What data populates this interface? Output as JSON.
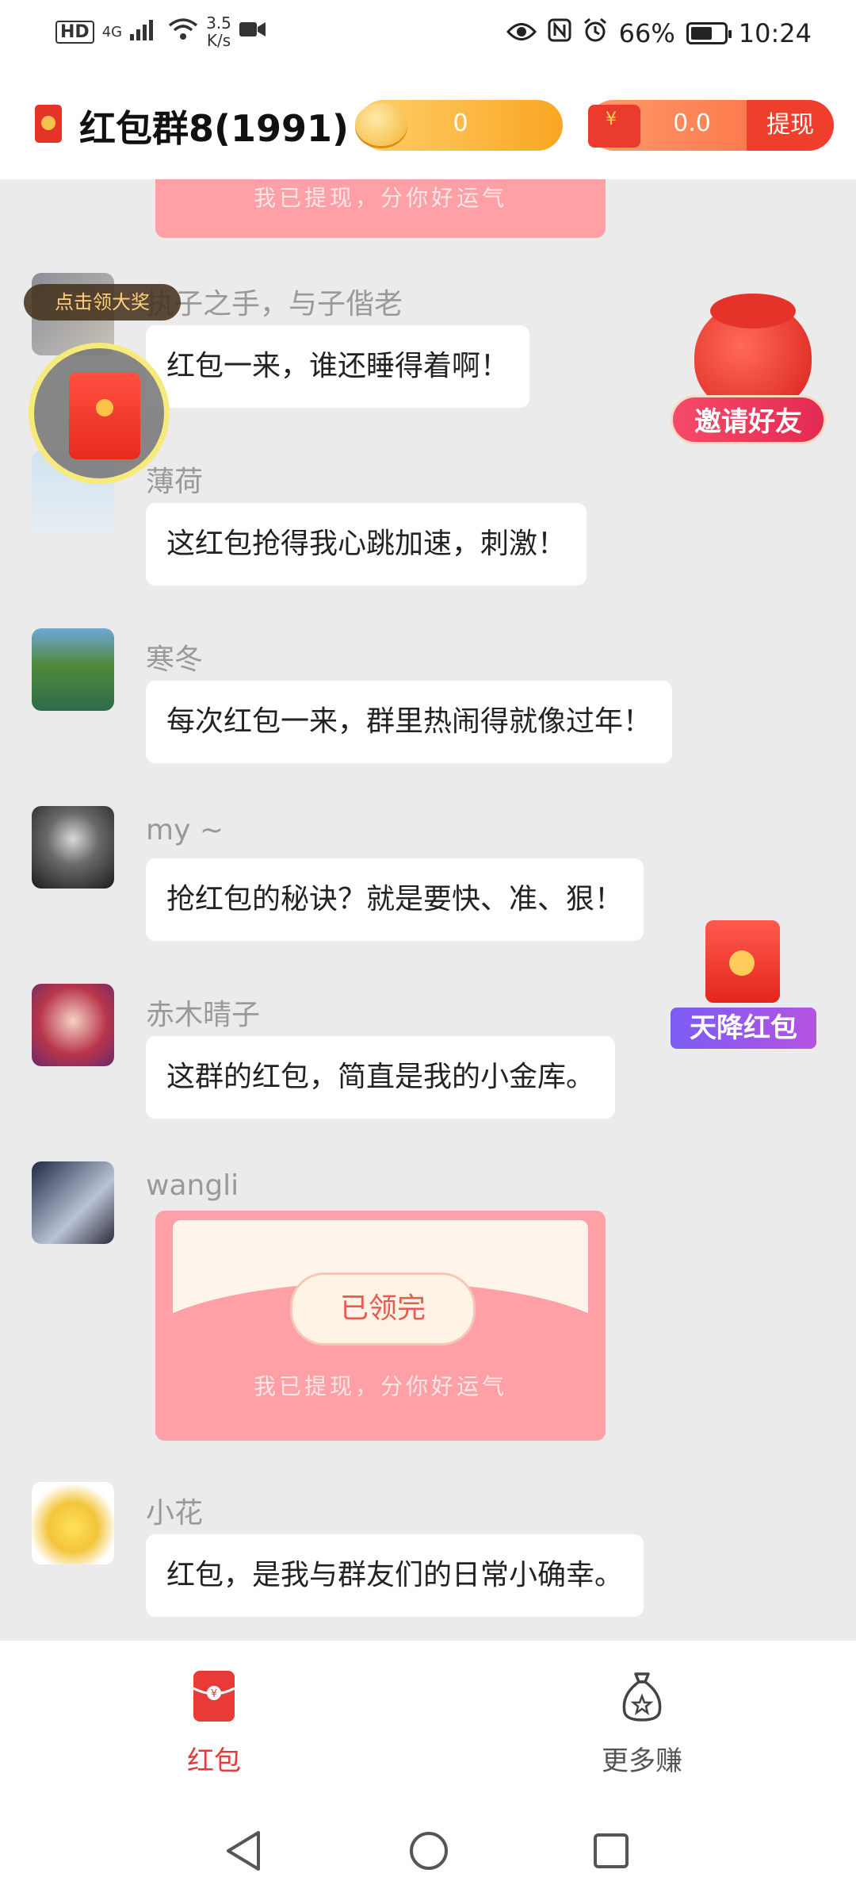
{
  "status": {
    "hd": "HD",
    "net_type": "4G",
    "speed_value": "3.5",
    "speed_unit": "K/s",
    "battery": "66%",
    "battery_level": 0.66,
    "time": "10:24"
  },
  "header": {
    "title": "红包群8(1991)",
    "coins": "0",
    "cash": "0.0",
    "withdraw": "提现"
  },
  "chat": {
    "top_card_note": "我已提现，分你好运气",
    "messages": [
      {
        "name": "执子之手，与子偕老",
        "text": "红包一来，谁还睡得着啊！"
      },
      {
        "name": "薄荷",
        "text": "这红包抢得我心跳加速，刺激！"
      },
      {
        "name": "寒冬",
        "text": "每次红包一来，群里热闹得就像过年！"
      },
      {
        "name": "my ~",
        "text": "抢红包的秘诀？就是要快、准、狠！"
      },
      {
        "name": "赤木晴子",
        "text": "这群的红包，简直是我的小金库。"
      }
    ],
    "red_packet": {
      "name": "wangli",
      "status": "已领完",
      "note": "我已提现，分你好运气"
    },
    "last": {
      "name": "小花",
      "text": "红包，是我与群友们的日常小确幸。"
    }
  },
  "floats": {
    "grab_tip": "点击领大奖",
    "invite": "邀请好友",
    "sky": "天降红包"
  },
  "tabs": [
    {
      "label": "红包",
      "color": "#e83a36"
    },
    {
      "label": "更多赚",
      "color": "#555555"
    }
  ]
}
